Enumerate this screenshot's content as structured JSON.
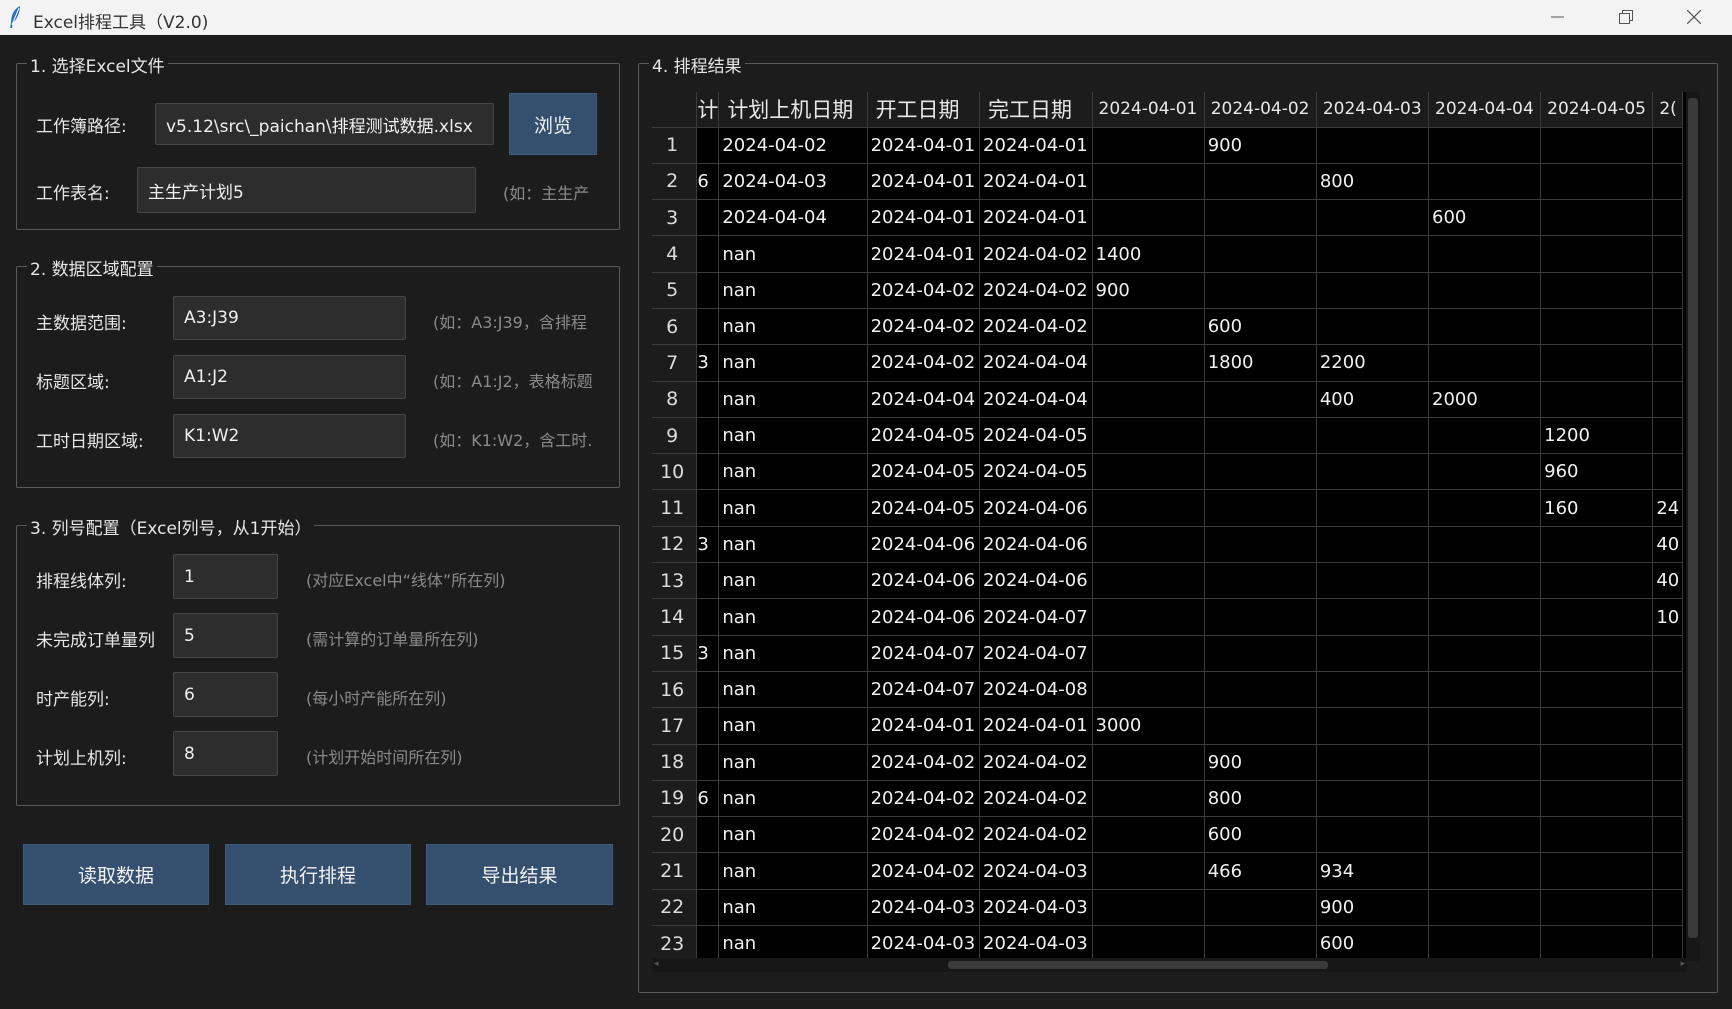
{
  "window": {
    "title": "Excel排程工具（V2.0)"
  },
  "section1": {
    "title": "1. 选择Excel文件",
    "workbook_label": "工作簿路径:",
    "workbook_value": "v5.12\\src\\_paichan\\排程测试数据.xlsx",
    "browse_label": "浏览",
    "sheet_label": "工作表名:",
    "sheet_value": "主生产计划5",
    "sheet_hint": "(如：主生产"
  },
  "section2": {
    "title": "2. 数据区域配置",
    "main_range_label": "主数据范围:",
    "main_range_value": "A3:J39",
    "main_range_hint": "(如：A3:J39，含排程",
    "title_area_label": "标题区域:",
    "title_area_value": "A1:J2",
    "title_area_hint": "(如：A1:J2，表格标题",
    "hours_area_label": "工时日期区域:",
    "hours_area_value": "K1:W2",
    "hours_area_hint": "(如：K1:W2，含工时."
  },
  "section3": {
    "title": "3. 列号配置（Excel列号，从1开始）",
    "line_col_label": "排程线体列:",
    "line_col_value": "1",
    "line_col_hint": "(对应Excel中“线体”所在列)",
    "order_col_label": "未完成订单量列",
    "order_col_value": "5",
    "order_col_hint": "(需计算的订单量所在列)",
    "capacity_col_label": "时产能列:",
    "capacity_col_value": "6",
    "capacity_col_hint": "(每小时产能所在列)",
    "plan_col_label": "计划上机列:",
    "plan_col_value": "8",
    "plan_col_hint": "(计划开始时间所在列)"
  },
  "actions": {
    "read_label": "读取数据",
    "run_label": "执行排程",
    "export_label": "导出结果"
  },
  "results": {
    "title": "4. 排程结果",
    "columns": [
      "计",
      "计划上机日期",
      "开工日期",
      "完工日期",
      "2024-04-01",
      "2024-04-02",
      "2024-04-03",
      "2024-04-04",
      "2024-04-05",
      "2("
    ],
    "rows": [
      [
        "1",
        "",
        "2024-04-02",
        "2024-04-01",
        "2024-04-01",
        "",
        "900",
        "",
        "",
        "",
        ""
      ],
      [
        "2",
        "6",
        "2024-04-03",
        "2024-04-01",
        "2024-04-01",
        "",
        "",
        "800",
        "",
        "",
        ""
      ],
      [
        "3",
        "",
        "2024-04-04",
        "2024-04-01",
        "2024-04-01",
        "",
        "",
        "",
        "600",
        "",
        ""
      ],
      [
        "4",
        "",
        "nan",
        "2024-04-01",
        "2024-04-02",
        "1400",
        "",
        "",
        "",
        "",
        ""
      ],
      [
        "5",
        "",
        "nan",
        "2024-04-02",
        "2024-04-02",
        "900",
        "",
        "",
        "",
        "",
        ""
      ],
      [
        "6",
        "",
        "nan",
        "2024-04-02",
        "2024-04-02",
        "",
        "600",
        "",
        "",
        "",
        ""
      ],
      [
        "7",
        "3",
        "nan",
        "2024-04-02",
        "2024-04-04",
        "",
        "1800",
        "2200",
        "",
        "",
        ""
      ],
      [
        "8",
        "",
        "nan",
        "2024-04-04",
        "2024-04-04",
        "",
        "",
        "400",
        "2000",
        "",
        ""
      ],
      [
        "9",
        "",
        "nan",
        "2024-04-05",
        "2024-04-05",
        "",
        "",
        "",
        "",
        "1200",
        ""
      ],
      [
        "10",
        "",
        "nan",
        "2024-04-05",
        "2024-04-05",
        "",
        "",
        "",
        "",
        "960",
        ""
      ],
      [
        "11",
        "",
        "nan",
        "2024-04-05",
        "2024-04-06",
        "",
        "",
        "",
        "",
        "160",
        "24"
      ],
      [
        "12",
        "3",
        "nan",
        "2024-04-06",
        "2024-04-06",
        "",
        "",
        "",
        "",
        "",
        "40"
      ],
      [
        "13",
        "",
        "nan",
        "2024-04-06",
        "2024-04-06",
        "",
        "",
        "",
        "",
        "",
        "40"
      ],
      [
        "14",
        "",
        "nan",
        "2024-04-06",
        "2024-04-07",
        "",
        "",
        "",
        "",
        "",
        "10"
      ],
      [
        "15",
        "3",
        "nan",
        "2024-04-07",
        "2024-04-07",
        "",
        "",
        "",
        "",
        "",
        ""
      ],
      [
        "16",
        "",
        "nan",
        "2024-04-07",
        "2024-04-08",
        "",
        "",
        "",
        "",
        "",
        ""
      ],
      [
        "17",
        "",
        "nan",
        "2024-04-01",
        "2024-04-01",
        "3000",
        "",
        "",
        "",
        "",
        ""
      ],
      [
        "18",
        "",
        "nan",
        "2024-04-02",
        "2024-04-02",
        "",
        "900",
        "",
        "",
        "",
        ""
      ],
      [
        "19",
        "6",
        "nan",
        "2024-04-02",
        "2024-04-02",
        "",
        "800",
        "",
        "",
        "",
        ""
      ],
      [
        "20",
        "",
        "nan",
        "2024-04-02",
        "2024-04-02",
        "",
        "600",
        "",
        "",
        "",
        ""
      ],
      [
        "21",
        "",
        "nan",
        "2024-04-02",
        "2024-04-03",
        "",
        "466",
        "934",
        "",
        "",
        ""
      ],
      [
        "22",
        "",
        "nan",
        "2024-04-03",
        "2024-04-03",
        "",
        "",
        "900",
        "",
        "",
        ""
      ],
      [
        "23",
        "",
        "nan",
        "2024-04-03",
        "2024-04-03",
        "",
        "",
        "600",
        "",
        "",
        ""
      ]
    ]
  }
}
